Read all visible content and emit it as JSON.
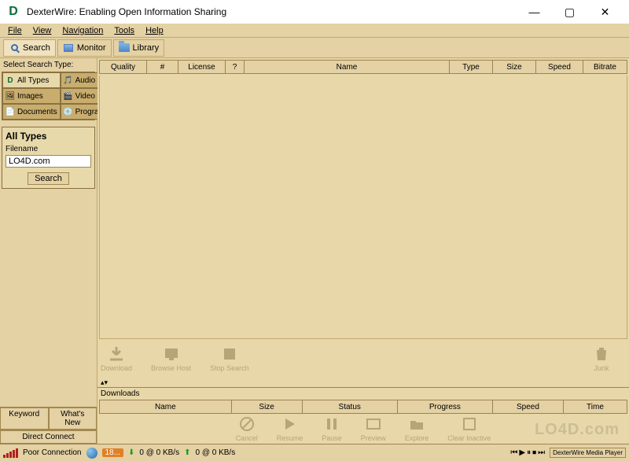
{
  "window": {
    "title": "DexterWire: Enabling Open Information Sharing"
  },
  "menu": {
    "file": "File",
    "view": "View",
    "navigation": "Navigation",
    "tools": "Tools",
    "help": "Help"
  },
  "maintabs": {
    "search": "Search",
    "monitor": "Monitor",
    "library": "Library"
  },
  "searchtypes_label": "Select Search Type:",
  "types": {
    "all": "All Types",
    "audio": "Audio",
    "images": "Images",
    "video": "Video",
    "documents": "Documents",
    "programs": "Programs"
  },
  "searchbox": {
    "heading": "All Types",
    "filename_label": "Filename",
    "value": "LO4D.com",
    "button": "Search"
  },
  "bottomtabs": {
    "keyword": "Keyword",
    "whatsnew": "What's New",
    "direct": "Direct Connect"
  },
  "results_columns": {
    "quality": "Quality",
    "num": "#",
    "license": "License",
    "help": "?",
    "name": "Name",
    "type": "Type",
    "size": "Size",
    "speed": "Speed",
    "bitrate": "Bitrate"
  },
  "result_actions": {
    "download": "Download",
    "browsehost": "Browse Host",
    "stopsearch": "Stop Search",
    "junk": "Junk"
  },
  "downloads_label": "Downloads",
  "downloads_columns": {
    "name": "Name",
    "size": "Size",
    "status": "Status",
    "progress": "Progress",
    "speed": "Speed",
    "time": "Time"
  },
  "download_actions": {
    "cancel": "Cancel",
    "resume": "Resume",
    "pause": "Pause",
    "preview": "Preview",
    "explore": "Explore",
    "clearinactive": "Clear Inactive"
  },
  "status": {
    "connection": "Poor Connection",
    "count": "18...",
    "down": "0 @ 0 KB/s",
    "up": "0 @ 0 KB/s",
    "player": "DexterWire Media Player"
  },
  "watermark": "LO4D.com"
}
